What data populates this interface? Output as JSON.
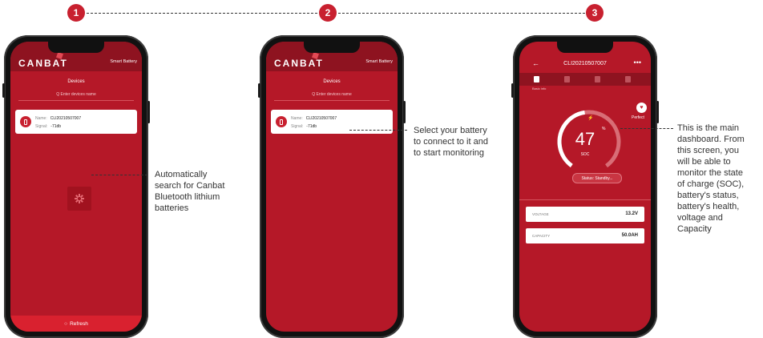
{
  "steps": [
    "1",
    "2",
    "3"
  ],
  "app": {
    "brand": "CANBAT",
    "header_right": "Smart Battery",
    "devices_title": "Devices",
    "search_placeholder": "Enter devices name",
    "search_glyph": "Q",
    "refresh_label": "Refresh",
    "refresh_glyph": "○"
  },
  "device": {
    "name_label": "Name:",
    "name_value": "CLI20210507007",
    "signal_label": "Signal:",
    "signal_value": "-71db"
  },
  "annotations": {
    "step1": [
      "Automatically",
      "search for Canbat",
      "Bluetooth lithium",
      "batteries"
    ],
    "step2": [
      "Select your battery",
      "to connect to it and",
      "to start monitoring"
    ],
    "step3": [
      "This is the main",
      "dashboard. From",
      "this screen, you",
      "will be able to",
      "monitor the state",
      "of charge (SOC),",
      "battery's status,",
      "battery's health,",
      "voltage and",
      "Capacity"
    ]
  },
  "dashboard": {
    "title": "CLI20210507007",
    "back_glyph": "←",
    "more_glyph": "•••",
    "tab_label": "Basic info",
    "soc_value": "47",
    "soc_unit": "%",
    "soc_label": "SOC",
    "soc_fraction": 0.47,
    "bolt_glyph": "⚡",
    "health_label": "Perfect",
    "health_glyph": "♥",
    "status_text": "Status: Standby...",
    "voltage_label": "VOLTAGE",
    "voltage_value": "13.2V",
    "capacity_label": "CAPACITY",
    "capacity_value": "50.0AH"
  },
  "icons": {
    "tabs": [
      "battery-icon",
      "document-icon",
      "lock-icon",
      "cart-icon"
    ],
    "refresh": "refresh-icon",
    "back": "arrow-left-icon",
    "more": "more-icon",
    "health": "heart-icon"
  },
  "colors": {
    "brand_red": "#c8202f",
    "screen_red": "#b51828",
    "dark_red": "#8e1320",
    "refresh_bar": "#d9212f",
    "text": "#333333"
  }
}
